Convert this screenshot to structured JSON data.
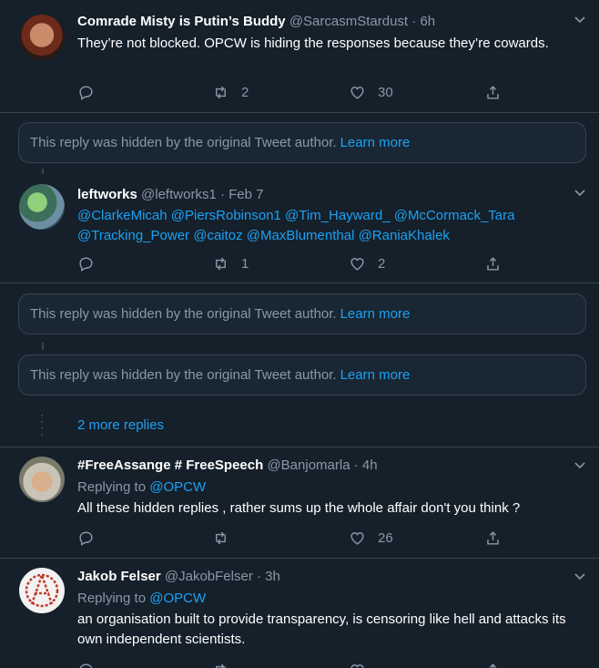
{
  "colors": {
    "background": "#15202b",
    "accent": "#1da1f2",
    "muted": "#8899a6",
    "border": "#38444d"
  },
  "tweets": [
    {
      "name": "Comrade Misty is Putin’s Buddy",
      "handle": "@SarcasmStardust",
      "separator": "·",
      "time": "6h",
      "text": "They’re not blocked. OPCW is hiding the responses because they’re cowards.",
      "replies": "",
      "retweets": "2",
      "likes": "30"
    },
    {
      "name": "leftworks",
      "handle": "@leftworks1",
      "separator": "·",
      "time": "Feb 7",
      "mentions_line1": "@ClarkeMicah @PiersRobinson1 @Tim_Hayward_ @McCormack_Tara",
      "mentions_line2": "@Tracking_Power @caitoz @MaxBlumenthal @RaniaKhalek",
      "replies": "",
      "retweets": "1",
      "likes": "2"
    },
    {
      "name": "#FreeAssange # FreeSpeech",
      "handle": "@Banjomarla",
      "separator": "·",
      "time": "4h",
      "replying_label": "Replying to",
      "replying_to": "@OPCW",
      "text": "All these hidden replies , rather sums up the whole affair don't you think ?",
      "replies": "",
      "retweets": "",
      "likes": "26"
    },
    {
      "name": "Jakob Felser",
      "handle": "@JakobFelser",
      "separator": "·",
      "time": "3h",
      "replying_label": "Replying to",
      "replying_to": "@OPCW",
      "text": "an organisation built to provide transparency, is censoring like hell and attacks its own independent scientists."
    }
  ],
  "hidden_notice": {
    "text": "This reply was hidden by the original Tweet author.",
    "learn_more": "Learn more"
  },
  "more_replies": "2 more replies",
  "icons": [
    "reply-icon",
    "retweet-icon",
    "like-icon",
    "share-icon",
    "chevron-down-icon"
  ]
}
